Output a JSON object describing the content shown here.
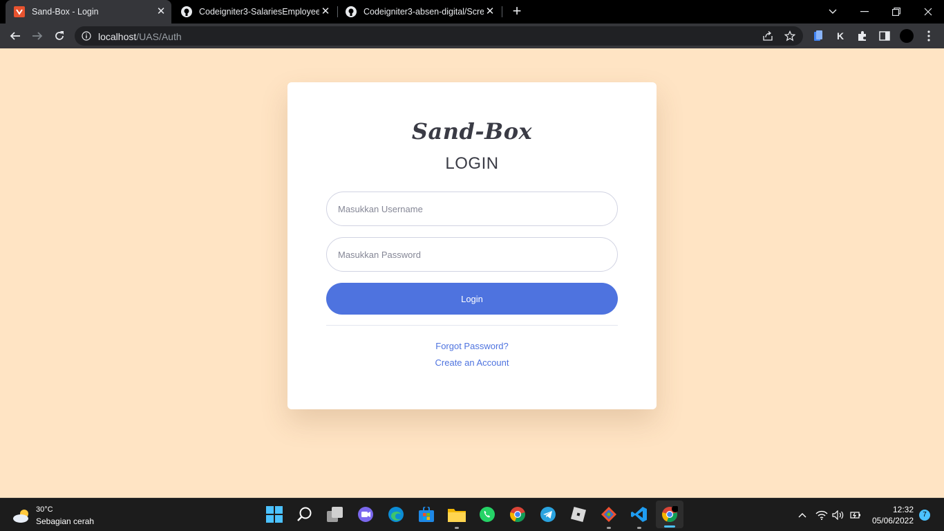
{
  "browser": {
    "tabs": [
      {
        "title": "Sand-Box - Login",
        "active": true,
        "favicon": "sandbox-logo-icon"
      },
      {
        "title": "Codeigniter3-SalariesEmployees/",
        "active": false,
        "favicon": "github-icon"
      },
      {
        "title": "Codeigniter3-absen-digital/Scree",
        "active": false,
        "favicon": "github-icon"
      }
    ],
    "url_host": "localhost",
    "url_path": "/UAS/Auth"
  },
  "page": {
    "brand": "Sand-Box",
    "heading": "LOGIN",
    "username_placeholder": "Masukkan Username",
    "password_placeholder": "Masukkan Password",
    "login_label": "Login",
    "forgot_label": "Forgot Password?",
    "create_label": "Create an Account"
  },
  "taskbar": {
    "weather_temp": "30°C",
    "weather_desc": "Sebagian cerah",
    "time": "12:32",
    "date": "05/06/2022",
    "notification_count": "7"
  },
  "colors": {
    "page_background": "#ffe4c4",
    "primary": "#4e73df",
    "card": "#ffffff"
  }
}
